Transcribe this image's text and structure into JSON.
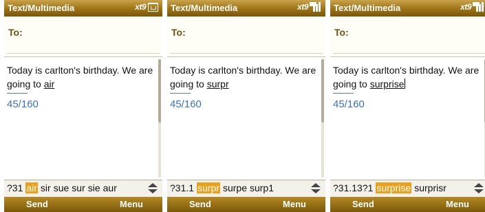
{
  "screens": [
    {
      "title": "Text/Multimedia",
      "input_mode": "xt9",
      "status_icon": "inbox-icon",
      "to_label": "To:",
      "message_prefix": "Today is carlton's birthday. We are going to ",
      "current_word": "air",
      "char_count": "45/160",
      "candidates": [
        "?31",
        "air",
        "sir",
        "sue",
        "sur",
        "sie",
        "aur"
      ],
      "selected_candidate": "air",
      "softkeys": {
        "left": "Send",
        "right": "Menu"
      }
    },
    {
      "title": "Text/Multimedia",
      "input_mode": "xt9",
      "status_icon": "signal-icon",
      "to_label": "To:",
      "message_prefix": "Today is carlton's birthday. We are going to ",
      "current_word": "surpr",
      "char_count": "45/160",
      "candidates": [
        "?31.1",
        "surpr",
        "surpe",
        "surp1"
      ],
      "selected_candidate": "surpr",
      "softkeys": {
        "left": "Send",
        "right": "Menu"
      }
    },
    {
      "title": "Text/Multimedia",
      "input_mode": "xt9",
      "status_icon": "signal-icon",
      "to_label": "To:",
      "message_prefix": "Today is carlton's birthday. We are going to ",
      "current_word": "surprise",
      "char_count": "45/160",
      "candidates": [
        "?31.13?1",
        "surprise",
        "surprisr"
      ],
      "selected_candidate": "surprise",
      "softkeys": {
        "left": "Send",
        "right": "Menu"
      }
    }
  ],
  "colors": {
    "titlebar": "#9c7214",
    "highlight": "#e8a119",
    "counter": "#3a72c2"
  }
}
